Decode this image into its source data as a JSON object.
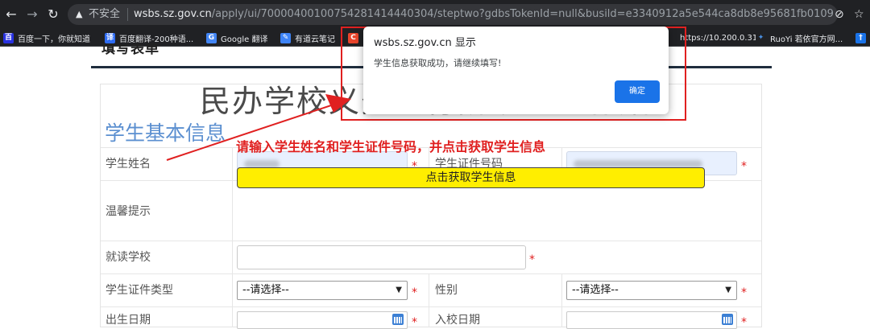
{
  "browser": {
    "security_label": "不安全",
    "url_host": "wsbs.sz.gov.cn",
    "url_path": "/apply/ui/7000040010075428141444030​4/steptwo?gdbsTokenId=null&busild=e3340912a5e544ca8db8e95681fb0109",
    "bookmarks": [
      {
        "label": "百度一下，你就知道",
        "icon": "paw-icon",
        "color": "#2932e1",
        "glyph": "百"
      },
      {
        "label": "百度翻译-200种语...",
        "icon": "translate-icon",
        "color": "#2f6df5",
        "glyph": "译"
      },
      {
        "label": "Google 翻译",
        "icon": "google-translate-icon",
        "color": "#4285f4",
        "glyph": "G"
      },
      {
        "label": "有道云笔记",
        "icon": "note-icon",
        "color": "#3d83f5",
        "glyph": "✎"
      },
      {
        "label": "",
        "icon": "c-logo-icon",
        "color": "#e8452c",
        "glyph": "C"
      },
      {
        "label": "https://10.200.0.31",
        "icon": "globe-icon",
        "color": "#5f6368",
        "glyph": ""
      },
      {
        "label": "RuoYi 若依官方网...",
        "icon": "ruoyi-icon",
        "color": "#202124",
        "glyph": "✦"
      },
      {
        "label": "",
        "icon": "pin-icon",
        "color": "#1a73e8",
        "glyph": "†"
      }
    ]
  },
  "page": {
    "header_title": "填写表单",
    "big_title": "民办学校义务教育阶段学位补贴",
    "section_title": "学生基本信息",
    "fields": {
      "student_name_label": "学生姓名",
      "student_id_label": "学生证件号码",
      "hint_label": "温馨提示",
      "hint_text": "请输入学生姓名和学生证件号码，并点击获取学生信息",
      "fetch_button": "点击获取学生信息",
      "school_label": "就读学校",
      "id_type_label": "学生证件类型",
      "id_type_value": "--请选择--",
      "gender_label": "性别",
      "gender_value": "--请选择--",
      "birth_label": "出生日期",
      "enroll_label": "入校日期",
      "required_mark": "*"
    }
  },
  "dialog": {
    "title": "wsbs.sz.gov.cn 显示",
    "message": "学生信息获取成功，请继续填写!",
    "ok_label": "确定"
  },
  "colors": {
    "accent_blue": "#1a73e8",
    "annotation_red": "#e02020",
    "fetch_button_yellow": "#ffee00",
    "section_title_blue": "#5b8fd0"
  }
}
